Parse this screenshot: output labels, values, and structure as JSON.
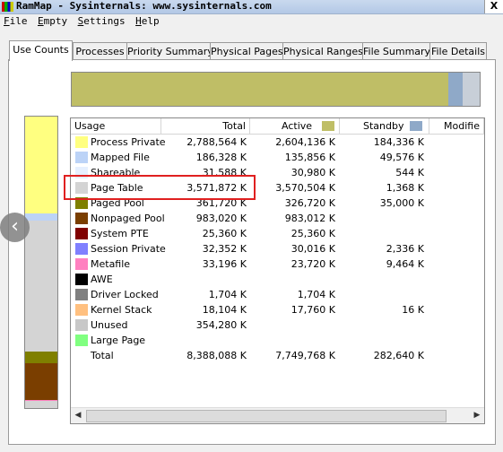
{
  "window": {
    "title": "RamMap - Sysinternals: www.sysinternals.com",
    "close_glyph": "X"
  },
  "menu": [
    "File",
    "Empty",
    "Settings",
    "Help"
  ],
  "tabs": [
    "Use Counts",
    "Processes",
    "Priority Summary",
    "Physical Pages",
    "Physical Ranges",
    "File Summary",
    "File Details"
  ],
  "active_tab": "Use Counts",
  "overall_bar": [
    {
      "name": "active",
      "fraction": 0.924,
      "color": "#bfbe66"
    },
    {
      "name": "standby",
      "fraction": 0.034,
      "color": "#8fa9c8"
    },
    {
      "name": "other",
      "fraction": 0.042,
      "color": "#c8cfd8"
    }
  ],
  "vertical_bar": [
    {
      "name": "process-private",
      "fraction": 0.35,
      "color": "#ffff80"
    },
    {
      "name": "mapped-file",
      "fraction": 0.025,
      "color": "#bcd3f7"
    },
    {
      "name": "page-table",
      "fraction": 0.47,
      "color": "#d4d4d4"
    },
    {
      "name": "paged-pool",
      "fraction": 0.045,
      "color": "#7f7f00"
    },
    {
      "name": "nonpaged-pool",
      "fraction": 0.13,
      "color": "#7a3e00"
    },
    {
      "name": "metafile",
      "fraction": 0.005,
      "color": "#ff80c0"
    },
    {
      "name": "rest",
      "fraction": 0.025,
      "color": "#d4d4d4"
    }
  ],
  "columns": {
    "usage": "Usage",
    "total": "Total",
    "active": "Active",
    "standby": "Standby",
    "modified": "Modifie"
  },
  "column_colors": {
    "active": "#bfbe66",
    "standby": "#8fa9c8"
  },
  "rows": [
    {
      "label": "Process Private",
      "total": "2,788,564 K",
      "active": "2,604,136 K",
      "standby": "184,336 K",
      "color": "#ffff80"
    },
    {
      "label": "Mapped File",
      "total": "186,328 K",
      "active": "135,856 K",
      "standby": "49,576 K",
      "color": "#bcd3f7"
    },
    {
      "label": "Shareable",
      "total": "31,588 K",
      "active": "30,980 K",
      "standby": "544 K",
      "color": "#e6f0ff"
    },
    {
      "label": "Page Table",
      "total": "3,571,872 K",
      "active": "3,570,504 K",
      "standby": "1,368 K",
      "color": "#d4d4d4"
    },
    {
      "label": "Paged Pool",
      "total": "361,720 K",
      "active": "326,720 K",
      "standby": "35,000 K",
      "color": "#7f7f00"
    },
    {
      "label": "Nonpaged Pool",
      "total": "983,020 K",
      "active": "983,012 K",
      "standby": "",
      "color": "#7a3e00"
    },
    {
      "label": "System PTE",
      "total": "25,360 K",
      "active": "25,360 K",
      "standby": "",
      "color": "#800000"
    },
    {
      "label": "Session Private",
      "total": "32,352 K",
      "active": "30,016 K",
      "standby": "2,336 K",
      "color": "#8080ff"
    },
    {
      "label": "Metafile",
      "total": "33,196 K",
      "active": "23,720 K",
      "standby": "9,464 K",
      "color": "#ff80c0"
    },
    {
      "label": "AWE",
      "total": "",
      "active": "",
      "standby": "",
      "color": "#000000"
    },
    {
      "label": "Driver Locked",
      "total": "1,704 K",
      "active": "1,704 K",
      "standby": "",
      "color": "#808080"
    },
    {
      "label": "Kernel Stack",
      "total": "18,104 K",
      "active": "17,760 K",
      "standby": "16 K",
      "color": "#ffc080"
    },
    {
      "label": "Unused",
      "total": "354,280 K",
      "active": "",
      "standby": "",
      "color": "#c8c8c8"
    },
    {
      "label": "Large Page",
      "total": "",
      "active": "",
      "standby": "",
      "color": "#80ff80"
    },
    {
      "label": "Total",
      "total": "8,388,088 K",
      "active": "7,749,768 K",
      "standby": "282,640 K",
      "color": ""
    }
  ],
  "highlighted_row": "Page Table",
  "nav_glyph": "‹"
}
